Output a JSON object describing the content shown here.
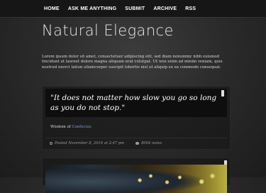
{
  "nav": {
    "items": [
      {
        "label": "HOME"
      },
      {
        "label": "ASK ME ANYTHING"
      },
      {
        "label": "SUBMIT"
      },
      {
        "label": "ARCHIVE"
      },
      {
        "label": "RSS"
      }
    ]
  },
  "blog": {
    "title": "Natural Elegance",
    "description": "Lorem ipsum dolor sit amet, consectetuer adipiscing elit, sed diam nonummy nibh euismod tincidunt ut laoreet dolore magna aliquam erat volutpat. Ut wisi enim ad minim veniam, quis nostrud exerci tation ullamcorper suscipit lobortis nisl ut aliquip ex ea commodo consequat."
  },
  "posts": [
    {
      "type": "quote",
      "quote": "\"It does not matter how slow you go so long as you do not stop.\"",
      "source_prefix": "Wisdom of ",
      "source_link": "Confucius",
      "date": "Posted November 8, 2016 at 2:47 pm",
      "notes": "8004 notes"
    },
    {
      "type": "photo"
    }
  ],
  "colors": {
    "accent_link": "#7a9fd6",
    "nav_bar": "#161616",
    "background": "#2a2a2a"
  }
}
